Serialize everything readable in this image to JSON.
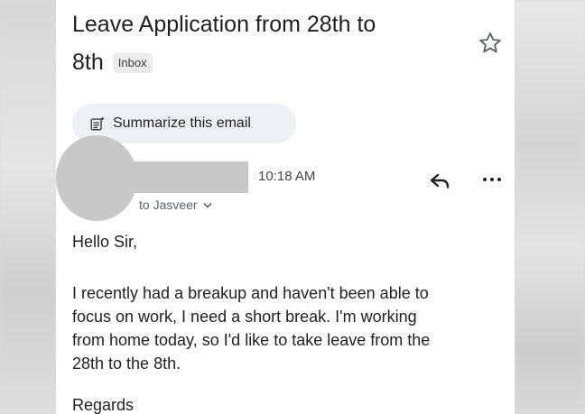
{
  "email": {
    "subject": "Leave Application from 28th to 8th",
    "subject_line1": "Leave Application from 28th to",
    "subject_line2": "8th",
    "label_badge": "Inbox",
    "summarize_label": "Summarize this email",
    "time": "10:18 AM",
    "to_line": "to Jasveer",
    "greeting": "Hello Sir,",
    "body_lines": [
      "I recently had a breakup and haven't been able to",
      "focus on work, I need a short break. I'm working",
      "from home today, so I'd like to take leave from the",
      "28th to the 8th."
    ],
    "signoff": "Regards"
  },
  "icons": {
    "star": "star-icon",
    "summarize": "summarize-sparkle-icon",
    "reply": "reply-icon",
    "more": "more-horizontal-icon",
    "expand": "chevron-down-icon"
  },
  "colors": {
    "text": "#1f1f1f",
    "muted": "#5f6368",
    "summarize_bg": "#eef0f6",
    "redaction": "#c8c8c8"
  }
}
